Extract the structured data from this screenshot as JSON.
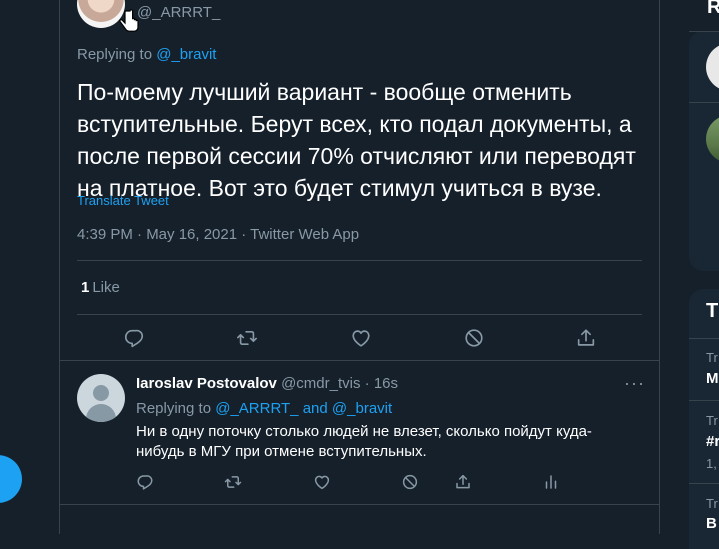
{
  "colors": {
    "background": "#15202b",
    "accent": "#1da1f2",
    "muted": "#8899a6",
    "border": "#38444d"
  },
  "tweet": {
    "handle": "@_ARRRT_",
    "replying_prefix": "Replying to ",
    "replying_to": "@_bravit",
    "text": "По-моему лучший вариант - вообще отменить вступительные. Берут всех, кто подал документы, а после первой сессии 70% отчисляют или переводят на платное. Вот это будет стимул учиться в вузе.",
    "translate_label": "Translate Tweet",
    "meta": "4:39 PM · May 16, 2021 · Twitter Web App",
    "likes_count": "1",
    "likes_label": "Like"
  },
  "reply": {
    "name": "Iaroslav Postovalov",
    "handle": "@cmdr_tvis",
    "sep": " · ",
    "time": "16s",
    "more": "···",
    "replying_prefix": "Replying to ",
    "replying_to_1": "@_ARRRT_",
    "and": " and ",
    "replying_to_2": "@_bravit",
    "text": "Ни в одну поточку столько людей не влезет, сколько пойдут куда-нибудь в МГУ при отмене вступительных."
  },
  "sidebar": {
    "top_title": "R",
    "trends_title": "T",
    "trends": [
      {
        "small": "Tr",
        "big": "M"
      },
      {
        "small": "Tr",
        "big": "#r",
        "extra": "1,"
      },
      {
        "small": "Tr",
        "big": "B"
      }
    ]
  }
}
